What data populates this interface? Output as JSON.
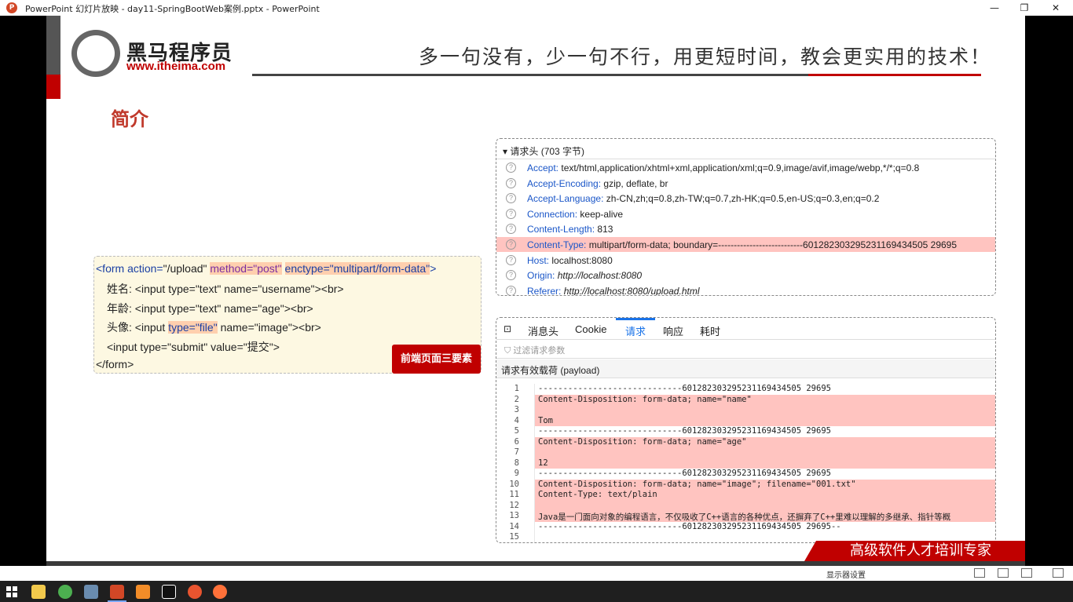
{
  "window": {
    "title": "PowerPoint 幻灯片放映 - day11-SpringBootWeb案例.pptx - PowerPoint",
    "app_icon": "P",
    "controls": [
      "—",
      "❐",
      "✕"
    ]
  },
  "slide": {
    "logo_cn": "黑马程序员",
    "logo_url": "www.itheima.com",
    "slogan": "多一句没有，少一句不行，用更短时间，教会更实用的技术！",
    "heading": "简介",
    "code": {
      "l1_open": "<form action=",
      "l1_action": "\"/upload\"",
      "l1_method": "method=\"post\"",
      "l1_enctype": "enctype=\"multipart/form-data\"",
      "l1_close": ">",
      "l2": "姓名: <input type=\"text\" name=\"username\"><br>",
      "l3": "年龄: <input type=\"text\" name=\"age\"><br>",
      "l4_a": "头像: <input ",
      "l4_type": "type=\"file\"",
      "l4_b": " name=\"image\"><br>",
      "l5": "<input type=\"submit\" value=\"提交\">",
      "l6": "</form>"
    },
    "red_label": "前端页面三要素",
    "banner": "高级软件人才培训专家"
  },
  "headers_panel": {
    "title": "请求头 (703 字节)",
    "rows": [
      {
        "key": "Accept:",
        "value": "text/html,application/xhtml+xml,application/xml;q=0.9,image/avif,image/webp,*/*;q=0.8"
      },
      {
        "key": "Accept-Encoding:",
        "value": "gzip, deflate, br"
      },
      {
        "key": "Accept-Language:",
        "value": "zh-CN,zh;q=0.8,zh-TW;q=0.7,zh-HK;q=0.5,en-US;q=0.3,en;q=0.2"
      },
      {
        "key": "Connection:",
        "value": "keep-alive"
      },
      {
        "key": "Content-Length:",
        "value": "813"
      },
      {
        "key": "Content-Type:",
        "value": "multipart/form-data; boundary=---------------------------601282303295231169434505 29695"
      },
      {
        "key": "Host:",
        "value": "localhost:8080"
      },
      {
        "key": "Origin:",
        "value": "http://localhost:8080"
      },
      {
        "key": "Referer:",
        "value": "http://localhost:8080/upload.html"
      }
    ]
  },
  "request_panel": {
    "tabs": [
      "消息头",
      "Cookie",
      "请求",
      "响应",
      "耗时"
    ],
    "active_tab": "请求",
    "filter_placeholder": "过滤请求参数",
    "payload_label": "请求有效载荷 (payload)",
    "lines": [
      {
        "n": "1",
        "text": "-----------------------------601282303295231169434505 29695"
      },
      {
        "n": "2",
        "text": "Content-Disposition: form-data; name=\"name\""
      },
      {
        "n": "3",
        "text": ""
      },
      {
        "n": "4",
        "text": "Tom"
      },
      {
        "n": "5",
        "text": "-----------------------------601282303295231169434505 29695"
      },
      {
        "n": "6",
        "text": "Content-Disposition: form-data; name=\"age\""
      },
      {
        "n": "7",
        "text": ""
      },
      {
        "n": "8",
        "text": "12"
      },
      {
        "n": "9",
        "text": "-----------------------------601282303295231169434505 29695"
      },
      {
        "n": "10",
        "text": "Content-Disposition: form-data; name=\"image\"; filename=\"001.txt\""
      },
      {
        "n": "11",
        "text": "Content-Type: text/plain"
      },
      {
        "n": "12",
        "text": ""
      },
      {
        "n": "13",
        "text": "Java是一门面向对象的编程语言，不仅吸收了C++语言的各种优点，还摒弃了C++里难以理解的多继承、指针等概"
      },
      {
        "n": "14",
        "text": "-----------------------------601282303295231169434505 29695--"
      },
      {
        "n": "15",
        "text": ""
      }
    ]
  },
  "statusbar": {
    "display_settings": "显示器设置"
  }
}
